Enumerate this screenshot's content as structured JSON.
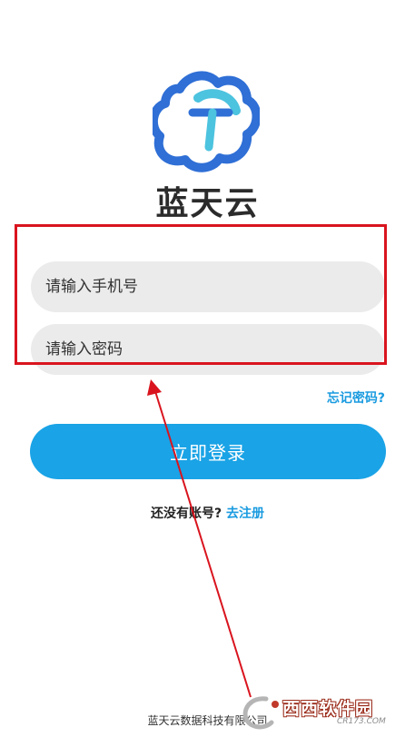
{
  "app": {
    "name": "蓝天云"
  },
  "form": {
    "phone_placeholder": "请输入手机号",
    "password_placeholder": "请输入密码",
    "forgot_label": "忘记密码?",
    "login_label": "立即登录"
  },
  "register": {
    "prompt": "还没有账号?",
    "link_label": "去注册"
  },
  "footer": {
    "company": "蓝天云数据科技有限公司"
  },
  "watermark": {
    "main": "西西软件园",
    "sub": "CR173.COM"
  },
  "colors": {
    "accent": "#1aa3e6",
    "link": "#1a9be0",
    "annotation": "#d9141e"
  }
}
